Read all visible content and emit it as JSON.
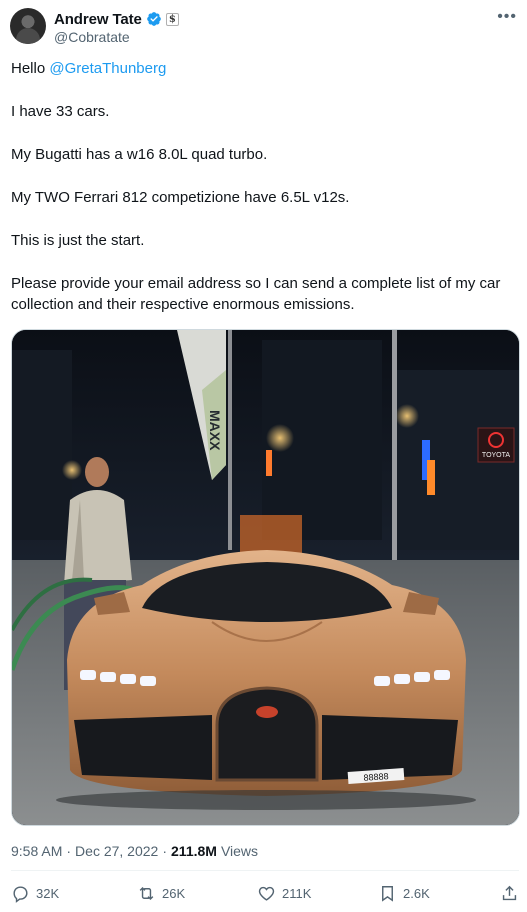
{
  "author": {
    "name": "Andrew Tate",
    "handle": "@Cobratate",
    "affiliation_badge": "$"
  },
  "tweet": {
    "greeting": "Hello ",
    "mention": "@GretaThunberg",
    "lines": [
      "I have 33 cars.",
      "My Bugatti has a w16 8.0L quad turbo.",
      "My TWO Ferrari 812 competizione have 6.5L v12s.",
      "This is just the start.",
      "Please provide your email address so I can send a complete list of my car collection and their respective enormous emissions."
    ]
  },
  "photo": {
    "flag_text": "MAXX",
    "sign_text": "TOYOTA",
    "plate_text": "88888"
  },
  "meta": {
    "time": "9:58 AM",
    "separator": "·",
    "date": "Dec 27, 2022",
    "views_count": "211.8M",
    "views_label": "Views"
  },
  "actions": {
    "replies": "32K",
    "retweets": "26K",
    "likes": "211K",
    "bookmarks": "2.6K"
  },
  "colors": {
    "accent": "#1d9bf0",
    "secondary_text": "#536471",
    "car_body": "#c48a5c"
  }
}
